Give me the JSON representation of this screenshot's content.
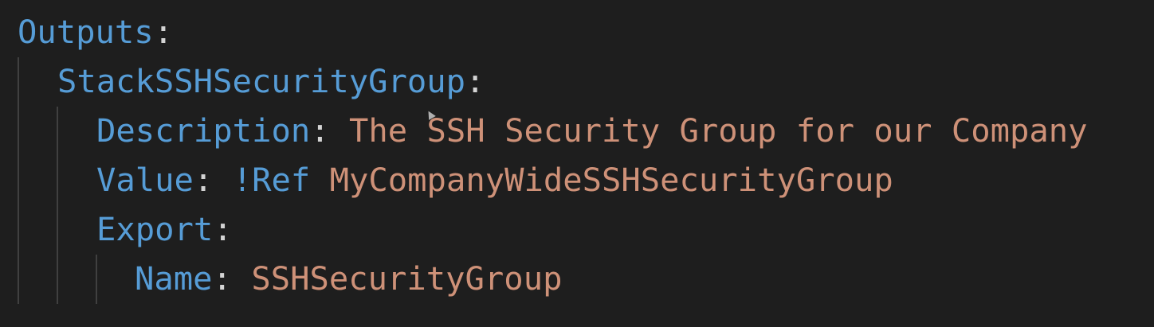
{
  "code": {
    "outputs_key": "Outputs",
    "resource_key": "StackSSHSecurityGroup",
    "description_key": "Description",
    "description_value": "The SSH Security Group for our Company",
    "value_key": "Value",
    "ref_tag": "!Ref",
    "value_ref": "MyCompanyWideSSHSecurityGroup",
    "export_key": "Export",
    "name_key": "Name",
    "name_value": "SSHSecurityGroup",
    "colon": ":"
  },
  "colors": {
    "background": "#1e1e1e",
    "key": "#569cd6",
    "string": "#ce9178",
    "punctuation": "#d4d4d4"
  }
}
